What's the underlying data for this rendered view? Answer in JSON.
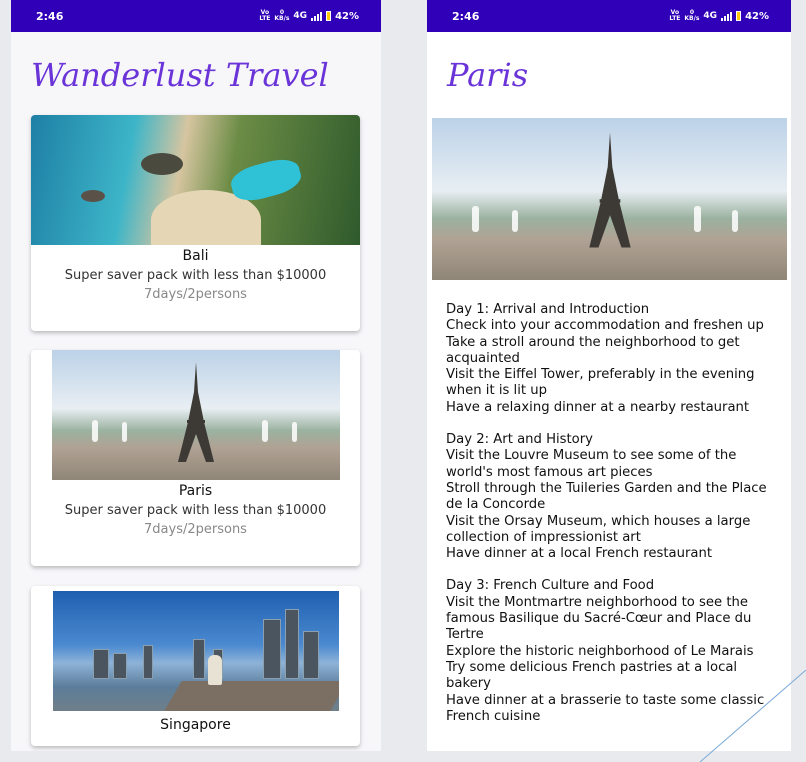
{
  "left_screen": {
    "status": {
      "time": "2:46",
      "network": "4G",
      "battery": "42%"
    },
    "app_title": "Wanderlust Travel",
    "destinations": [
      {
        "name": "Bali",
        "description": "Super saver pack with less than $10000",
        "duration": "7days/2persons"
      },
      {
        "name": "Paris",
        "description": "Super saver pack with less than $10000",
        "duration": "7days/2persons"
      },
      {
        "name": "Singapore"
      }
    ]
  },
  "right_screen": {
    "status": {
      "time": "2:46",
      "network": "4G",
      "battery": "42%"
    },
    "title": "Paris",
    "itinerary": [
      {
        "lines": [
          "Day 1: Arrival and Introduction",
          "Check into your accommodation and freshen up",
          "Take a stroll around the neighborhood to get acquainted",
          "Visit the Eiffel Tower, preferably in the evening when it is lit up",
          "Have a relaxing dinner at a nearby restaurant"
        ]
      },
      {
        "lines": [
          "Day 2: Art and History",
          "Visit the Louvre Museum to see some of the world's most famous art pieces",
          "Stroll through the Tuileries Garden and the Place de la Concorde",
          "Visit the Orsay Museum, which houses a large collection of impressionist art",
          "Have dinner at a local French restaurant"
        ]
      },
      {
        "lines": [
          "Day 3: French Culture and Food",
          "Visit the Montmartre neighborhood to see the famous Basilique du Sacré-Cœur and Place du Tertre",
          "Explore the historic neighborhood of Le Marais",
          "Try some delicious French pastries at a local bakery",
          "Have dinner at a brasserie to taste some classic French cuisine"
        ]
      }
    ]
  },
  "colors": {
    "status_bar": "#2f00b8",
    "title": "#6a34d8",
    "battery": "#ffcc00"
  },
  "icons": [
    "signal-bars-icon",
    "battery-icon",
    "volte-icon",
    "data-speed-icon"
  ]
}
